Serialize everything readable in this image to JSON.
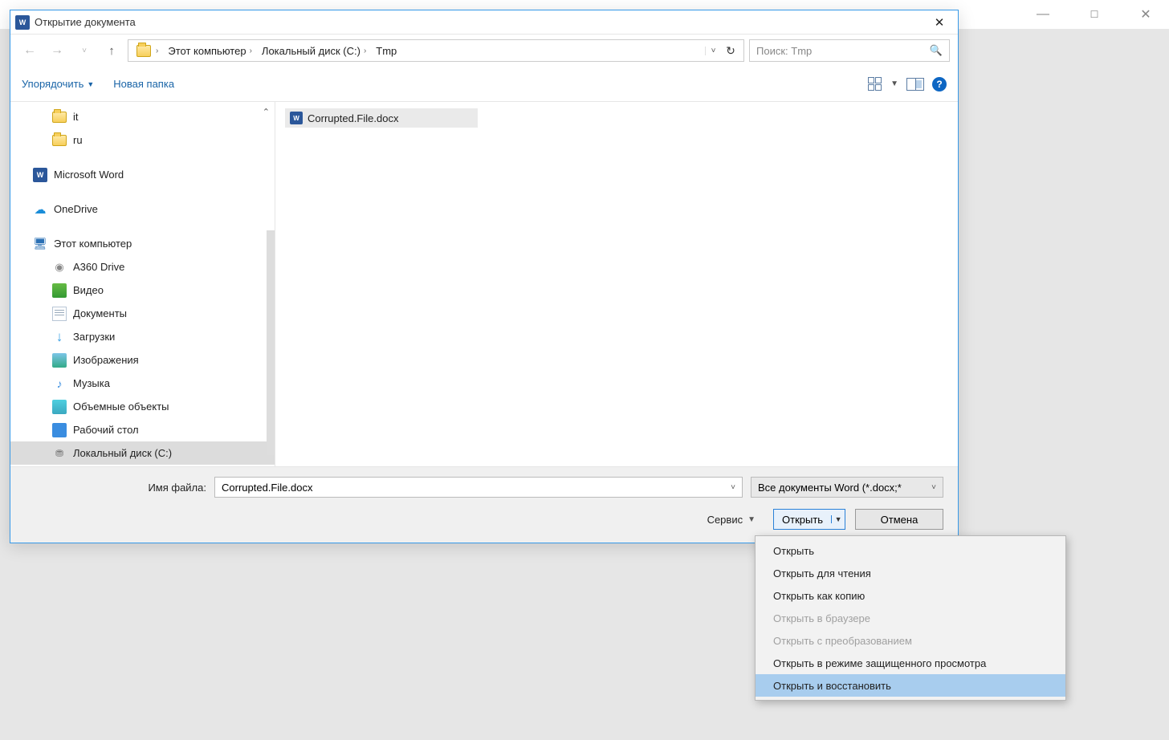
{
  "backgroundWindow": {
    "sysButtons": {
      "minimize": "—",
      "maximize": "☐",
      "close": "✕"
    }
  },
  "dialog": {
    "title": "Открытие документа",
    "close": "✕"
  },
  "nav": {
    "breadcrumb": {
      "root": "Этот компьютер",
      "drive": "Локальный диск (C:)",
      "folder": "Tmp"
    },
    "search": {
      "placeholder": "Поиск: Tmp"
    }
  },
  "toolbar": {
    "organize": "Упорядочить",
    "newFolder": "Новая папка"
  },
  "sidebar": {
    "items": [
      {
        "label": "it",
        "level": 1,
        "icon": "folder"
      },
      {
        "label": "ru",
        "level": 1,
        "icon": "folder"
      },
      {
        "label": "Microsoft Word",
        "level": 0,
        "icon": "word"
      },
      {
        "label": "OneDrive",
        "level": 0,
        "icon": "onedrive"
      },
      {
        "label": "Этот компьютер",
        "level": 0,
        "icon": "pc"
      },
      {
        "label": "A360 Drive",
        "level": 1,
        "icon": "a360"
      },
      {
        "label": "Видео",
        "level": 1,
        "icon": "video"
      },
      {
        "label": "Документы",
        "level": 1,
        "icon": "docs"
      },
      {
        "label": "Загрузки",
        "level": 1,
        "icon": "dl"
      },
      {
        "label": "Изображения",
        "level": 1,
        "icon": "pics"
      },
      {
        "label": "Музыка",
        "level": 1,
        "icon": "music"
      },
      {
        "label": "Объемные объекты",
        "level": 1,
        "icon": "3d"
      },
      {
        "label": "Рабочий стол",
        "level": 1,
        "icon": "desk"
      },
      {
        "label": "Локальный диск (C:)",
        "level": 1,
        "icon": "disk",
        "selected": true
      }
    ]
  },
  "fileList": {
    "files": [
      {
        "name": "Corrupted.File.docx",
        "icon": "word"
      }
    ]
  },
  "footer": {
    "filenameLabel": "Имя файла:",
    "filenameValue": "Corrupted.File.docx",
    "filterValue": "Все документы Word (*.docx;*",
    "toolsLabel": "Сервис",
    "openLabel": "Открыть",
    "cancelLabel": "Отмена"
  },
  "dropdownMenu": {
    "items": [
      {
        "label": "Открыть",
        "state": "normal"
      },
      {
        "label": "Открыть для чтения",
        "state": "normal"
      },
      {
        "label": "Открыть как копию",
        "state": "normal"
      },
      {
        "label": "Открыть в браузере",
        "state": "disabled"
      },
      {
        "label": "Открыть с преобразованием",
        "state": "disabled"
      },
      {
        "label": "Открыть в режиме защищенного просмотра",
        "state": "normal"
      },
      {
        "label": "Открыть и восстановить",
        "state": "highlighted"
      }
    ]
  }
}
